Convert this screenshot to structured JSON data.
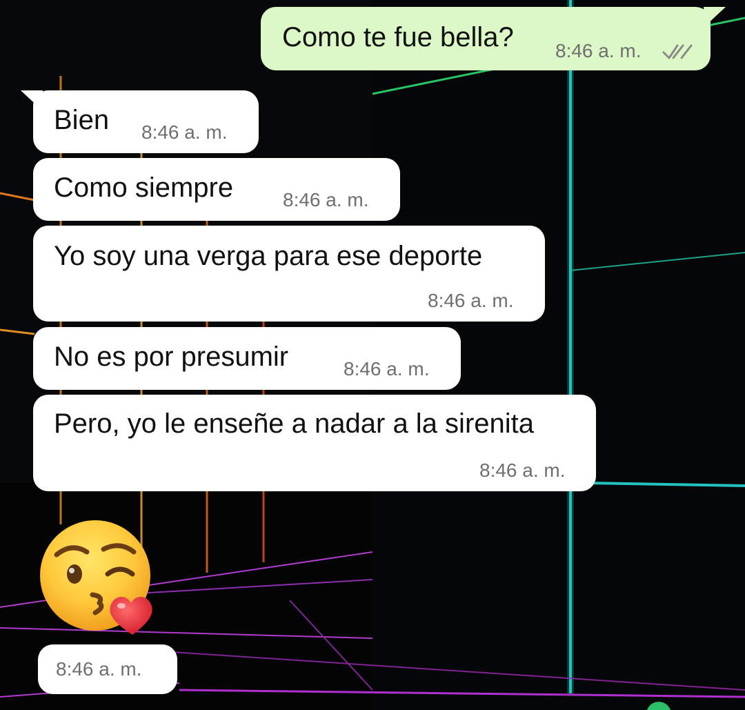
{
  "chat": {
    "colors": {
      "incoming_bubble": "#ffffff",
      "outgoing_bubble": "#dcf8c6",
      "timestamp": "#6f6f6f",
      "read_ticks": "#8a8a8a"
    },
    "messages": [
      {
        "direction": "outgoing",
        "text": "Como te fue bella?",
        "time": "8:46 a. m.",
        "status_icon": "double-check-icon"
      },
      {
        "direction": "incoming",
        "text": "Bien",
        "time": "8:46 a. m."
      },
      {
        "direction": "incoming",
        "text": "Como siempre",
        "time": "8:46 a. m."
      },
      {
        "direction": "incoming",
        "text": "Yo soy una verga para ese deporte",
        "time": "8:46 a. m."
      },
      {
        "direction": "incoming",
        "text": "No es por presumir",
        "time": "8:46 a. m."
      },
      {
        "direction": "incoming",
        "text": "Pero, yo le enseñe a nadar a la sirenita",
        "time": "8:46 a. m."
      },
      {
        "direction": "incoming",
        "emoji": "face-blowing-a-kiss-icon",
        "time": "8:46 a. m."
      }
    ]
  }
}
